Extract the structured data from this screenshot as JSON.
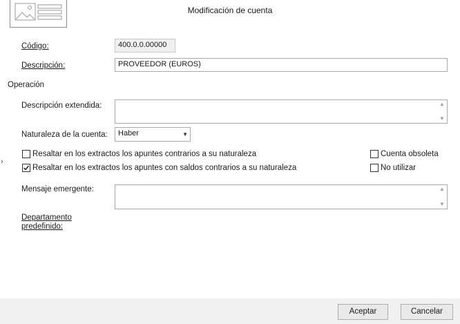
{
  "window": {
    "title": "Modificación de cuenta"
  },
  "form": {
    "codigo": {
      "label": "Código:",
      "value": "400.0.0.00000"
    },
    "descripcion": {
      "label": "Descripción:",
      "value": "PROVEEDOR (EUROS)"
    },
    "section_title": "Operación",
    "descripcion_extendida": {
      "label": "Descripción extendida:",
      "value": ""
    },
    "naturaleza": {
      "label": "Naturaleza de la cuenta:",
      "value": "Haber"
    },
    "checkboxes": [
      {
        "label": "Resaltar en los extractos los apuntes contrarios a su naturaleza",
        "checked": false
      },
      {
        "label": "Resaltar en los extractos los apuntes con saldos contrarios a su naturaleza",
        "checked": true
      },
      {
        "label": "Cuenta obsoleta",
        "checked": false
      },
      {
        "label": "No utilizar",
        "checked": false
      }
    ],
    "mensaje_emergente": {
      "label": "Mensaje emergente:",
      "value": ""
    },
    "departamento": {
      "label_line1": "Departamento",
      "label_line2": "predefinido:"
    }
  },
  "buttons": {
    "accept": "Aceptar",
    "cancel": "Cancelar"
  },
  "icons": {
    "thumbnail": "image-placeholder-icon",
    "collapse": "chevron-right-icon",
    "dropdown": "chevron-down-icon",
    "scroll_up": "scroll-up-icon",
    "scroll_down": "scroll-down-icon",
    "checkmark": "checkmark-icon"
  }
}
